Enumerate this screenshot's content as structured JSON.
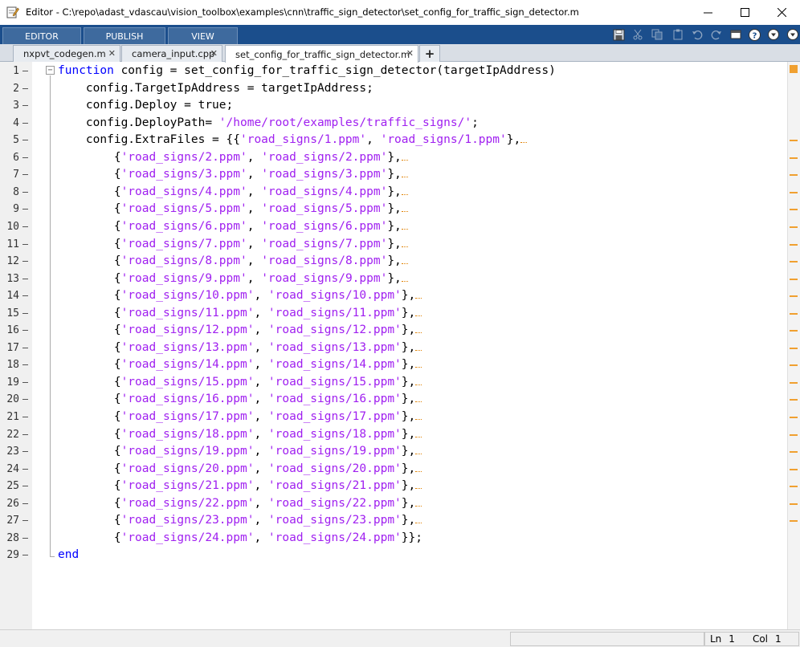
{
  "window": {
    "title": "Editor - C:\\repo\\adast_vdascau\\vision_toolbox\\examples\\cnn\\traffic_sign_detector\\set_config_for_traffic_sign_detector.m",
    "minimize": "—",
    "maximize": "☐",
    "close": "✕"
  },
  "toolstrip": {
    "tabs": [
      {
        "label": "EDITOR"
      },
      {
        "label": "PUBLISH"
      },
      {
        "label": "VIEW"
      }
    ],
    "quick_access": [
      "save-icon",
      "cut-icon",
      "copy-icon",
      "paste-icon",
      "undo-icon",
      "redo-icon",
      "window-icon",
      "help-icon",
      "dropdown-icon"
    ]
  },
  "document_tabs": [
    {
      "label": "nxpvt_codegen.m",
      "active": false
    },
    {
      "label": "camera_input.cpp",
      "active": false
    },
    {
      "label": "set_config_for_traffic_sign_detector.m",
      "active": true
    }
  ],
  "add_tab_label": "+",
  "code_lines": [
    {
      "n": "1",
      "parts": [
        [
          "kw",
          "function"
        ],
        [
          "t",
          " config = set_config_for_traffic_sign_detector(targetIpAddress)"
        ]
      ]
    },
    {
      "n": "2",
      "parts": [
        [
          "t",
          "    config.TargetIpAddress = targetIpAddress;"
        ]
      ]
    },
    {
      "n": "3",
      "parts": [
        [
          "t",
          "    config.Deploy = true;"
        ]
      ]
    },
    {
      "n": "4",
      "parts": [
        [
          "t",
          "    config.DeployPath= "
        ],
        [
          "str",
          "'/home/root/examples/traffic_signs/'"
        ],
        [
          "t",
          ";"
        ]
      ]
    },
    {
      "n": "5",
      "parts": [
        [
          "t",
          "    config.ExtraFiles = {{"
        ],
        [
          "str",
          "'road_signs/1.ppm'"
        ],
        [
          "t",
          ", "
        ],
        [
          "str",
          "'road_signs/1.ppm'"
        ],
        [
          "t",
          "},"
        ]
      ],
      "warn": true
    },
    {
      "n": "6",
      "parts": [
        [
          "t",
          "        {"
        ],
        [
          "str",
          "'road_signs/2.ppm'"
        ],
        [
          "t",
          ", "
        ],
        [
          "str",
          "'road_signs/2.ppm'"
        ],
        [
          "t",
          "},"
        ]
      ],
      "warn": true
    },
    {
      "n": "7",
      "parts": [
        [
          "t",
          "        {"
        ],
        [
          "str",
          "'road_signs/3.ppm'"
        ],
        [
          "t",
          ", "
        ],
        [
          "str",
          "'road_signs/3.ppm'"
        ],
        [
          "t",
          "},"
        ]
      ],
      "warn": true
    },
    {
      "n": "8",
      "parts": [
        [
          "t",
          "        {"
        ],
        [
          "str",
          "'road_signs/4.ppm'"
        ],
        [
          "t",
          ", "
        ],
        [
          "str",
          "'road_signs/4.ppm'"
        ],
        [
          "t",
          "},"
        ]
      ],
      "warn": true
    },
    {
      "n": "9",
      "parts": [
        [
          "t",
          "        {"
        ],
        [
          "str",
          "'road_signs/5.ppm'"
        ],
        [
          "t",
          ", "
        ],
        [
          "str",
          "'road_signs/5.ppm'"
        ],
        [
          "t",
          "},"
        ]
      ],
      "warn": true
    },
    {
      "n": "10",
      "parts": [
        [
          "t",
          "        {"
        ],
        [
          "str",
          "'road_signs/6.ppm'"
        ],
        [
          "t",
          ", "
        ],
        [
          "str",
          "'road_signs/6.ppm'"
        ],
        [
          "t",
          "},"
        ]
      ],
      "warn": true
    },
    {
      "n": "11",
      "parts": [
        [
          "t",
          "        {"
        ],
        [
          "str",
          "'road_signs/7.ppm'"
        ],
        [
          "t",
          ", "
        ],
        [
          "str",
          "'road_signs/7.ppm'"
        ],
        [
          "t",
          "},"
        ]
      ],
      "warn": true
    },
    {
      "n": "12",
      "parts": [
        [
          "t",
          "        {"
        ],
        [
          "str",
          "'road_signs/8.ppm'"
        ],
        [
          "t",
          ", "
        ],
        [
          "str",
          "'road_signs/8.ppm'"
        ],
        [
          "t",
          "},"
        ]
      ],
      "warn": true
    },
    {
      "n": "13",
      "parts": [
        [
          "t",
          "        {"
        ],
        [
          "str",
          "'road_signs/9.ppm'"
        ],
        [
          "t",
          ", "
        ],
        [
          "str",
          "'road_signs/9.ppm'"
        ],
        [
          "t",
          "},"
        ]
      ],
      "warn": true
    },
    {
      "n": "14",
      "parts": [
        [
          "t",
          "        {"
        ],
        [
          "str",
          "'road_signs/10.ppm'"
        ],
        [
          "t",
          ", "
        ],
        [
          "str",
          "'road_signs/10.ppm'"
        ],
        [
          "t",
          "},"
        ]
      ],
      "warn": true
    },
    {
      "n": "15",
      "parts": [
        [
          "t",
          "        {"
        ],
        [
          "str",
          "'road_signs/11.ppm'"
        ],
        [
          "t",
          ", "
        ],
        [
          "str",
          "'road_signs/11.ppm'"
        ],
        [
          "t",
          "},"
        ]
      ],
      "warn": true
    },
    {
      "n": "16",
      "parts": [
        [
          "t",
          "        {"
        ],
        [
          "str",
          "'road_signs/12.ppm'"
        ],
        [
          "t",
          ", "
        ],
        [
          "str",
          "'road_signs/12.ppm'"
        ],
        [
          "t",
          "},"
        ]
      ],
      "warn": true
    },
    {
      "n": "17",
      "parts": [
        [
          "t",
          "        {"
        ],
        [
          "str",
          "'road_signs/13.ppm'"
        ],
        [
          "t",
          ", "
        ],
        [
          "str",
          "'road_signs/13.ppm'"
        ],
        [
          "t",
          "},"
        ]
      ],
      "warn": true
    },
    {
      "n": "18",
      "parts": [
        [
          "t",
          "        {"
        ],
        [
          "str",
          "'road_signs/14.ppm'"
        ],
        [
          "t",
          ", "
        ],
        [
          "str",
          "'road_signs/14.ppm'"
        ],
        [
          "t",
          "},"
        ]
      ],
      "warn": true
    },
    {
      "n": "19",
      "parts": [
        [
          "t",
          "        {"
        ],
        [
          "str",
          "'road_signs/15.ppm'"
        ],
        [
          "t",
          ", "
        ],
        [
          "str",
          "'road_signs/15.ppm'"
        ],
        [
          "t",
          "},"
        ]
      ],
      "warn": true
    },
    {
      "n": "20",
      "parts": [
        [
          "t",
          "        {"
        ],
        [
          "str",
          "'road_signs/16.ppm'"
        ],
        [
          "t",
          ", "
        ],
        [
          "str",
          "'road_signs/16.ppm'"
        ],
        [
          "t",
          "},"
        ]
      ],
      "warn": true
    },
    {
      "n": "21",
      "parts": [
        [
          "t",
          "        {"
        ],
        [
          "str",
          "'road_signs/17.ppm'"
        ],
        [
          "t",
          ", "
        ],
        [
          "str",
          "'road_signs/17.ppm'"
        ],
        [
          "t",
          "},"
        ]
      ],
      "warn": true
    },
    {
      "n": "22",
      "parts": [
        [
          "t",
          "        {"
        ],
        [
          "str",
          "'road_signs/18.ppm'"
        ],
        [
          "t",
          ", "
        ],
        [
          "str",
          "'road_signs/18.ppm'"
        ],
        [
          "t",
          "},"
        ]
      ],
      "warn": true
    },
    {
      "n": "23",
      "parts": [
        [
          "t",
          "        {"
        ],
        [
          "str",
          "'road_signs/19.ppm'"
        ],
        [
          "t",
          ", "
        ],
        [
          "str",
          "'road_signs/19.ppm'"
        ],
        [
          "t",
          "},"
        ]
      ],
      "warn": true
    },
    {
      "n": "24",
      "parts": [
        [
          "t",
          "        {"
        ],
        [
          "str",
          "'road_signs/20.ppm'"
        ],
        [
          "t",
          ", "
        ],
        [
          "str",
          "'road_signs/20.ppm'"
        ],
        [
          "t",
          "},"
        ]
      ],
      "warn": true
    },
    {
      "n": "25",
      "parts": [
        [
          "t",
          "        {"
        ],
        [
          "str",
          "'road_signs/21.ppm'"
        ],
        [
          "t",
          ", "
        ],
        [
          "str",
          "'road_signs/21.ppm'"
        ],
        [
          "t",
          "},"
        ]
      ],
      "warn": true
    },
    {
      "n": "26",
      "parts": [
        [
          "t",
          "        {"
        ],
        [
          "str",
          "'road_signs/22.ppm'"
        ],
        [
          "t",
          ", "
        ],
        [
          "str",
          "'road_signs/22.ppm'"
        ],
        [
          "t",
          "},"
        ]
      ],
      "warn": true
    },
    {
      "n": "27",
      "parts": [
        [
          "t",
          "        {"
        ],
        [
          "str",
          "'road_signs/23.ppm'"
        ],
        [
          "t",
          ", "
        ],
        [
          "str",
          "'road_signs/23.ppm'"
        ],
        [
          "t",
          "},"
        ]
      ],
      "warn": true
    },
    {
      "n": "28",
      "parts": [
        [
          "t",
          "        {"
        ],
        [
          "str",
          "'road_signs/24.ppm'"
        ],
        [
          "t",
          ", "
        ],
        [
          "str",
          "'road_signs/24.ppm'"
        ],
        [
          "t",
          "}};"
        ]
      ]
    },
    {
      "n": "29",
      "parts": [
        [
          "kw",
          "end"
        ]
      ]
    }
  ],
  "status": {
    "ln_label": "Ln",
    "ln_value": "1",
    "col_label": "Col",
    "col_value": "1"
  },
  "colors": {
    "keyword": "#0000ff",
    "string": "#a020f0",
    "toolstrip_bg": "#1b4e8c",
    "warning": "#f0a030"
  }
}
